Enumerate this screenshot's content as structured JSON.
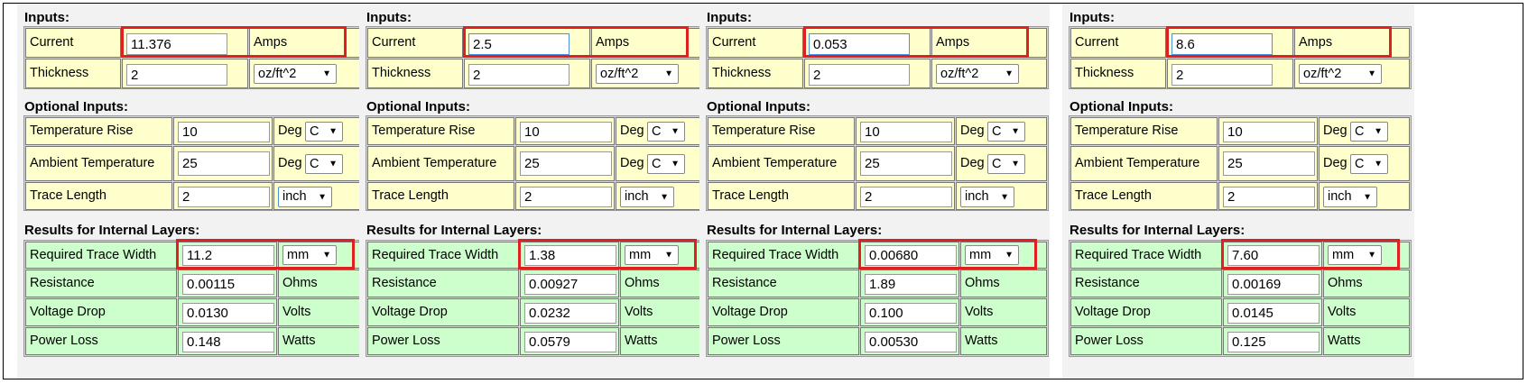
{
  "labels": {
    "inputs_title": "Inputs:",
    "optional_title": "Optional Inputs:",
    "results_title": "Results for Internal Layers:",
    "current": "Current",
    "thickness": "Thickness",
    "temp_rise": "Temperature Rise",
    "ambient": "Ambient Temperature",
    "trace_length": "Trace Length",
    "req_width": "Required Trace Width",
    "resistance": "Resistance",
    "voltage_drop": "Voltage Drop",
    "power_loss": "Power Loss",
    "amps": "Amps",
    "ohms": "Ohms",
    "volts": "Volts",
    "watts": "Watts",
    "deg": "Deg",
    "deg_unit": "C",
    "thickness_unit": "oz/ft^2",
    "length_unit": "inch",
    "width_unit": "mm"
  },
  "colors": {
    "input_bg": "#ffffcc",
    "result_bg": "#ccffcc",
    "highlight": "#e02020"
  },
  "panels": [
    {
      "current": "11.376",
      "thickness": "2",
      "temp_rise": "10",
      "ambient": "25",
      "trace_length": "2",
      "req_width": "11.2",
      "resistance": "0.00115",
      "voltage_drop": "0.0130",
      "power_loss": "0.148"
    },
    {
      "current": "2.5",
      "thickness": "2",
      "temp_rise": "10",
      "ambient": "25",
      "trace_length": "2",
      "req_width": "1.38",
      "resistance": "0.00927",
      "voltage_drop": "0.0232",
      "power_loss": "0.0579"
    },
    {
      "current": "0.053",
      "thickness": "2",
      "temp_rise": "10",
      "ambient": "25",
      "trace_length": "2",
      "req_width": "0.00680",
      "resistance": "1.89",
      "voltage_drop": "0.100",
      "power_loss": "0.00530"
    },
    {
      "current": "8.6",
      "thickness": "2",
      "temp_rise": "10",
      "ambient": "25",
      "trace_length": "2",
      "req_width": "7.60",
      "resistance": "0.00169",
      "voltage_drop": "0.0145",
      "power_loss": "0.125"
    }
  ]
}
